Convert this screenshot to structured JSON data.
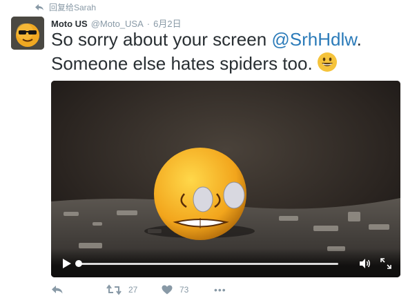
{
  "reply_context": {
    "icon": "reply-arrow-icon",
    "text": "回复给Sarah"
  },
  "author": {
    "name": "Moto US",
    "handle": "@Moto_USA",
    "separator": "·",
    "date": "6月2日",
    "avatar": "sunglasses-emoji-avatar"
  },
  "tweet": {
    "text_before": "So sorry about your screen ",
    "mention": "@SrhHdlw",
    "text_after": ". Someone else hates spiders too.",
    "emoji": "grinning-face-emoji"
  },
  "video": {
    "description_icon": "scared-emoji-ball",
    "progress": 0.0,
    "controls": [
      "play-icon",
      "volume-icon",
      "fullscreen-icon"
    ]
  },
  "actions": {
    "reply": {
      "icon": "reply-icon"
    },
    "retweet": {
      "icon": "retweet-icon",
      "count": "27"
    },
    "like": {
      "icon": "heart-icon",
      "count": "73"
    },
    "more": {
      "icon": "more-dots-icon",
      "label": "•••"
    }
  },
  "colors": {
    "text": "#292f33",
    "muted": "#8899a6",
    "link": "#2b7bb9"
  }
}
